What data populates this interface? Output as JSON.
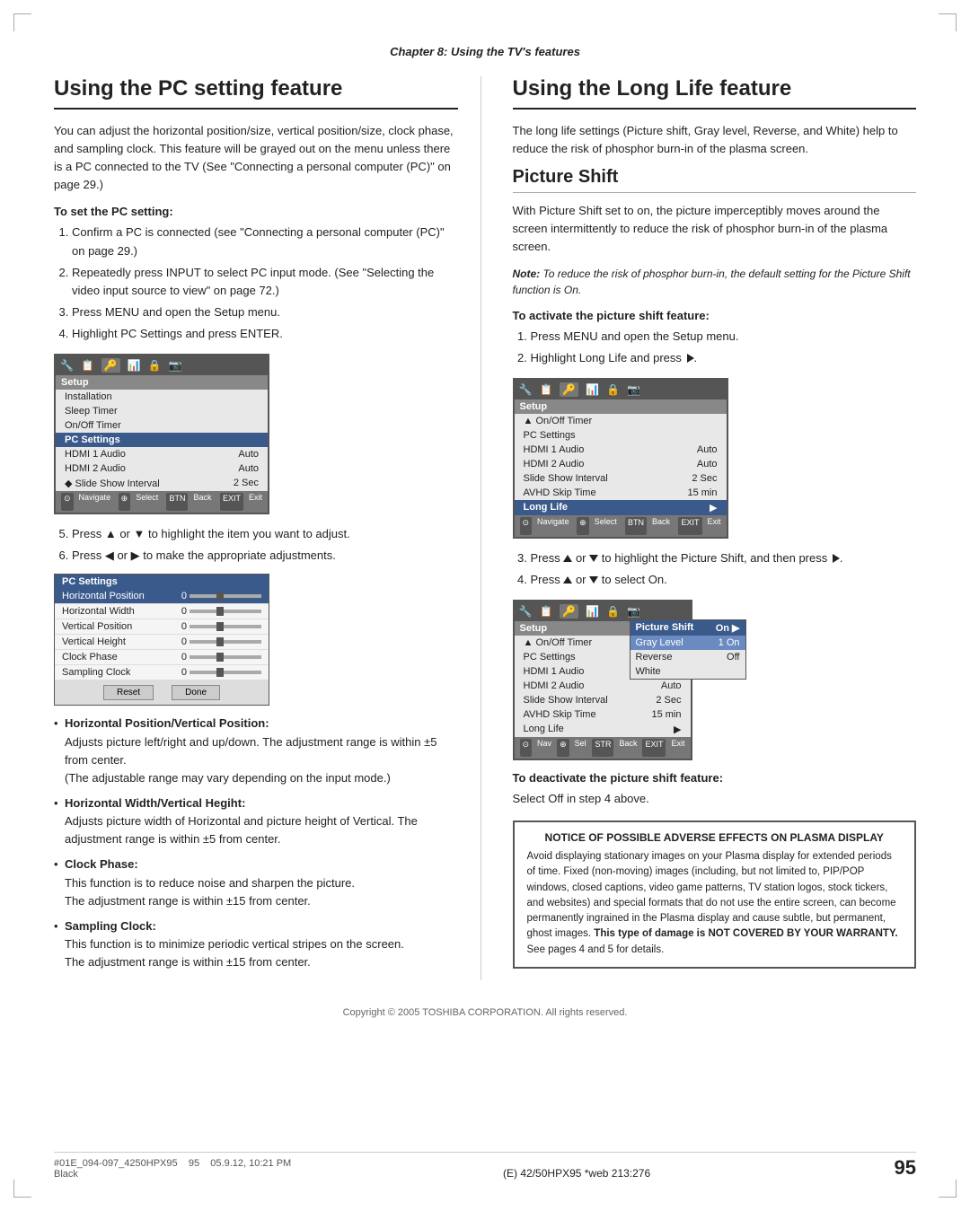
{
  "page": {
    "chapter_header": "Chapter 8: Using the TV's features",
    "copyright": "Copyright © 2005 TOSHIBA CORPORATION. All rights reserved.",
    "page_number": "95",
    "footer_left": "#01E_094-097_4250HPX95     95     05.9.12, 10:21 PM",
    "footer_center": "(E) 42/50HPX95 *web 213:276",
    "footer_black": "Black"
  },
  "left_column": {
    "section_title": "Using the PC setting feature",
    "intro": "You can adjust the horizontal position/size, vertical position/size, clock phase, and sampling clock. This feature will be grayed out on the menu unless there is a PC connected to the TV (See \"Connecting a personal computer (PC)\" on page 29.)",
    "to_set_label": "To set the PC setting:",
    "steps": [
      "Confirm a PC is connected (see \"Connecting a personal computer (PC)\" on page 29.)",
      "Repeatedly press INPUT to select PC input mode. (See \"Selecting the video input source to view\" on page 72.)",
      "Press MENU and open the Setup menu.",
      "Highlight PC Settings and press ENTER.",
      "Press ▲ or ▼ to highlight the item you want to adjust.",
      "Press ◀ or ▶ to make the appropriate adjustments."
    ],
    "bullets": [
      {
        "title": "Horizontal Position/Vertical Position:",
        "text": "Adjusts picture left/right and up/down. The adjustment range is within ±5 from center.",
        "note": "(The adjustable range may vary depending on the input mode.)"
      },
      {
        "title": "Horizontal Width/Vertical Hegiht:",
        "text": "Adjusts picture width of Horizontal and picture height of Vertical. The adjustment range is within ±5 from center."
      },
      {
        "title": "Clock Phase:",
        "text": "This function is to reduce noise and sharpen the picture.",
        "text2": "The adjustment range is within ±15 from center."
      },
      {
        "title": "Sampling Clock:",
        "text": "This function is to minimize periodic vertical stripes on the screen.",
        "text2": "The adjustment range is within ±15 from center."
      }
    ],
    "menu1": {
      "icons": [
        "🔧",
        "📋",
        "🔑",
        "📊",
        "🔒"
      ],
      "title": "Setup",
      "rows": [
        {
          "label": "Installation",
          "value": ""
        },
        {
          "label": "Sleep Timer",
          "value": ""
        },
        {
          "label": "On/Off Timer",
          "value": ""
        },
        {
          "label": "PC Settings",
          "value": "",
          "highlight": true
        },
        {
          "label": "HDMI 1 Audio",
          "value": "Auto"
        },
        {
          "label": "HDMI 2 Audio",
          "value": "Auto"
        },
        {
          "label": "◆ Slide Show Interval",
          "value": "2 Sec"
        }
      ],
      "nav": "⊙ Navigate  ⊕ Select  [BTN] Back  [EXIT] Exit"
    },
    "menu2": {
      "title": "PC Settings",
      "rows": [
        {
          "label": "Horizontal Position",
          "value": "0",
          "highlight": true
        },
        {
          "label": "Horizontal Width",
          "value": "0"
        },
        {
          "label": "Vertical Position",
          "value": "0"
        },
        {
          "label": "Vertical Height",
          "value": "0"
        },
        {
          "label": "Clock Phase",
          "value": "0"
        },
        {
          "label": "Sampling Clock",
          "value": "0"
        }
      ],
      "buttons": [
        "Reset",
        "Done"
      ]
    }
  },
  "right_column": {
    "section_title": "Using the Long Life feature",
    "intro": "The long life settings (Picture shift, Gray level, Reverse, and White) help to reduce the risk of phosphor burn-in of the plasma screen.",
    "subsection_title": "Picture Shift",
    "picture_shift_intro": "With Picture Shift set to on, the picture imperceptibly moves around the screen intermittently to reduce the risk of phosphor burn-in of the plasma screen.",
    "note": "Note: To reduce the risk of phosphor burn-in, the default setting for the Picture Shift function is On.",
    "activate_label": "To activate the picture shift feature:",
    "activate_steps": [
      "Press MENU and open the Setup menu.",
      "Highlight Long Life and press ▶."
    ],
    "step3": "Press ▲ or ▼ to highlight the Picture Shift, and then press ▶.",
    "step4": "Press ▲ or ▼ to select On.",
    "deactivate_label": "To deactivate the picture shift feature:",
    "deactivate_text": "Select Off in step 4 above.",
    "menu3": {
      "title": "Setup",
      "rows": [
        {
          "label": "▲ On/Off Timer",
          "value": ""
        },
        {
          "label": "PC Settings",
          "value": ""
        },
        {
          "label": "HDMI 1 Audio",
          "value": "Auto"
        },
        {
          "label": "HDMI 2 Audio",
          "value": "Auto"
        },
        {
          "label": "Slide Show Interval",
          "value": "2 Sec"
        },
        {
          "label": "AVHD Skip Time",
          "value": "15 min"
        },
        {
          "label": "Long Life",
          "value": "▶",
          "highlight": true
        }
      ],
      "nav": "⊙ Navigate  ⊕ Select  [BTN] Back  [EXIT] Exit"
    },
    "menu4": {
      "title": "Setup",
      "rows": [
        {
          "label": "▲ On/Off Timer",
          "value": ""
        },
        {
          "label": "PC Settings",
          "value": ""
        },
        {
          "label": "HDMI 1 Audio",
          "value": "Auto"
        },
        {
          "label": "HDMI 2 Audio",
          "value": "Auto"
        },
        {
          "label": "Slide Show Interval",
          "value": "2 Sec"
        },
        {
          "label": "AVHD Skip Time",
          "value": "15 min"
        },
        {
          "label": "Long Life",
          "value": "▶"
        }
      ],
      "submenu_rows": [
        {
          "label": "Picture Shift",
          "value": "On ▶",
          "highlight": true
        },
        {
          "label": "Gray Level",
          "value": "1 On"
        },
        {
          "label": "Reverse",
          "value": "Off"
        },
        {
          "label": "White",
          "value": ""
        }
      ],
      "nav": "⊙ Navigate  ⊕ Select  [STR] Back  [EXIT] Exit"
    },
    "notice": {
      "title": "NOTICE OF POSSIBLE ADVERSE EFFECTS ON PLASMA DISPLAY",
      "body": "Avoid displaying stationary images on your Plasma display for extended periods of time. Fixed (non-moving) images (including, but not limited to, PIP/POP windows, closed captions, video game patterns, TV station logos, stock tickers, and websites) and special formats that do not use the entire screen, can become permanently ingrained in the Plasma display and cause subtle, but permanent, ghost images.",
      "bold_text": "This type of damage is NOT COVERED BY YOUR WARRANTY.",
      "end_text": "  See pages 4 and 5 for details."
    }
  }
}
